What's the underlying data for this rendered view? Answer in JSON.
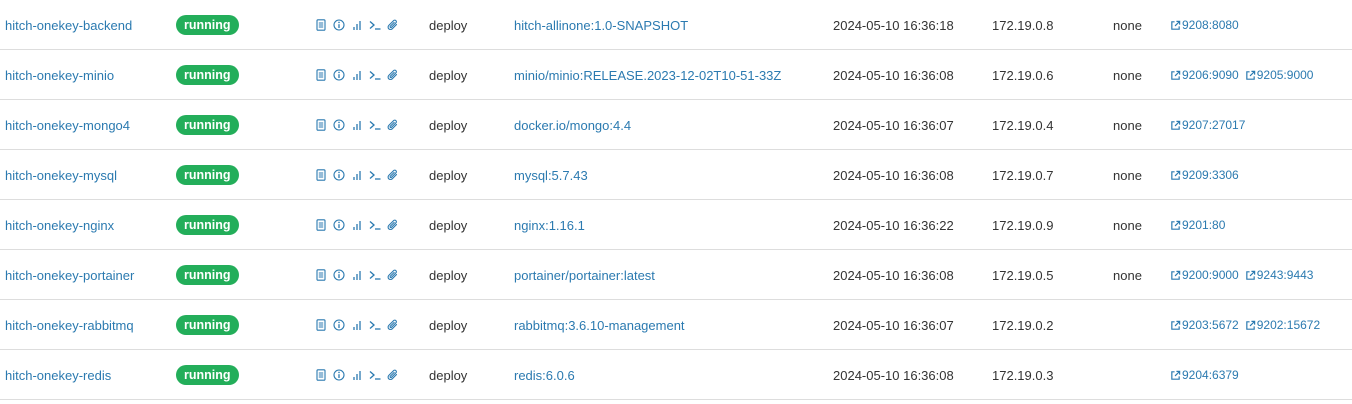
{
  "colors": {
    "link": "#2b7ab0",
    "running_badge": "#23ae5a",
    "text": "#333333",
    "row_border": "#dddddd"
  },
  "quick_action_icons": [
    "logs-icon",
    "inspect-icon",
    "stats-icon",
    "console-icon",
    "attach-icon"
  ],
  "containers": [
    {
      "name": "hitch-onekey-backend",
      "state": "running",
      "stack": "deploy",
      "image": "hitch-allinone:1.0-SNAPSHOT",
      "created": "2024-05-10 16:36:18",
      "ip": "172.19.0.8",
      "gpus": "none",
      "ports": [
        "9208:8080"
      ]
    },
    {
      "name": "hitch-onekey-minio",
      "state": "running",
      "stack": "deploy",
      "image": "minio/minio:RELEASE.2023-12-02T10-51-33Z",
      "created": "2024-05-10 16:36:08",
      "ip": "172.19.0.6",
      "gpus": "none",
      "ports": [
        "9206:9090",
        "9205:9000"
      ]
    },
    {
      "name": "hitch-onekey-mongo4",
      "state": "running",
      "stack": "deploy",
      "image": "docker.io/mongo:4.4",
      "created": "2024-05-10 16:36:07",
      "ip": "172.19.0.4",
      "gpus": "none",
      "ports": [
        "9207:27017"
      ]
    },
    {
      "name": "hitch-onekey-mysql",
      "state": "running",
      "stack": "deploy",
      "image": "mysql:5.7.43",
      "created": "2024-05-10 16:36:08",
      "ip": "172.19.0.7",
      "gpus": "none",
      "ports": [
        "9209:3306"
      ]
    },
    {
      "name": "hitch-onekey-nginx",
      "state": "running",
      "stack": "deploy",
      "image": "nginx:1.16.1",
      "created": "2024-05-10 16:36:22",
      "ip": "172.19.0.9",
      "gpus": "none",
      "ports": [
        "9201:80"
      ]
    },
    {
      "name": "hitch-onekey-portainer",
      "state": "running",
      "stack": "deploy",
      "image": "portainer/portainer:latest",
      "created": "2024-05-10 16:36:08",
      "ip": "172.19.0.5",
      "gpus": "none",
      "ports": [
        "9200:9000",
        "9243:9443"
      ]
    },
    {
      "name": "hitch-onekey-rabbitmq",
      "state": "running",
      "stack": "deploy",
      "image": "rabbitmq:3.6.10-management",
      "created": "2024-05-10 16:36:07",
      "ip": "172.19.0.2",
      "gpus": "",
      "ports": [
        "9203:5672",
        "9202:15672"
      ]
    },
    {
      "name": "hitch-onekey-redis",
      "state": "running",
      "stack": "deploy",
      "image": "redis:6.0.6",
      "created": "2024-05-10 16:36:08",
      "ip": "172.19.0.3",
      "gpus": "",
      "ports": [
        "9204:6379"
      ]
    }
  ]
}
